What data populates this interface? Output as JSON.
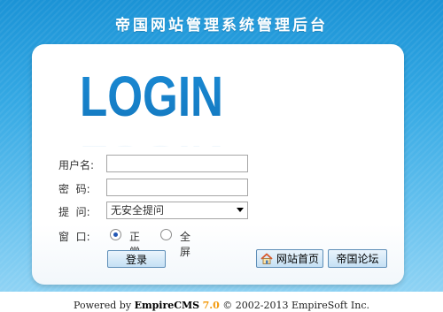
{
  "header": {
    "title": "帝国网站管理系统管理后台"
  },
  "logo": {
    "text": "LOGIN",
    "color": "#1a8ad4"
  },
  "form": {
    "username_label": "用户名:",
    "username_value": "",
    "password_label": "密  码:",
    "password_value": "",
    "question_label": "提  问:",
    "question_selected": "无安全提问",
    "window_label": "窗  口:",
    "window_options": [
      {
        "label": "正常",
        "checked": true
      },
      {
        "label": "全屏",
        "checked": false
      }
    ]
  },
  "buttons": {
    "login": "登录",
    "home": "网站首页",
    "forum": "帝国论坛"
  },
  "footer": {
    "prefix": "Powered by ",
    "brand": "EmpireCMS",
    "version": "7.0",
    "copyright": " © 2002-2013 EmpireSoft Inc."
  },
  "colors": {
    "header_blue": "#1b93d6",
    "accent_orange": "#f39c12"
  }
}
